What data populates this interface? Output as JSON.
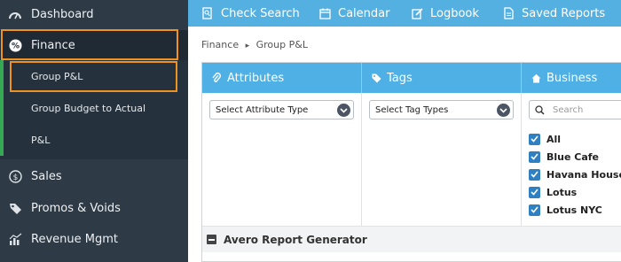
{
  "sidebar": {
    "dashboard": "Dashboard",
    "finance": "Finance",
    "finance_sub": [
      "Group P&L",
      "Group Budget to Actual",
      "P&L"
    ],
    "sales": "Sales",
    "promos": "Promos & Voids",
    "revenue": "Revenue Mgmt"
  },
  "topbar": {
    "check_search": "Check Search",
    "calendar": "Calendar",
    "logbook": "Logbook",
    "saved_reports": "Saved Reports"
  },
  "breadcrumb": [
    "Finance",
    "▸",
    "Group P&L"
  ],
  "panel": {
    "attributes": {
      "title": "Attributes",
      "select_value": "Select Attribute Type"
    },
    "tags": {
      "title": "Tags",
      "select_value": "Select Tag Types"
    },
    "business": {
      "title": "Business",
      "search_placeholder": "Search",
      "items": [
        {
          "label": "All",
          "checked": true
        },
        {
          "label": "Blue Cafe",
          "checked": true
        },
        {
          "label": "Havana House",
          "checked": true
        },
        {
          "label": "Lotus",
          "checked": true
        },
        {
          "label": "Lotus NYC",
          "checked": true
        }
      ]
    },
    "footer": "Avero Report Generator"
  },
  "colors": {
    "sidebar_bg": "#2e3a46",
    "accent_blue": "#55b0e2",
    "highlight_orange": "#f0921e",
    "active_green": "#34a853",
    "checkbox_blue": "#2f7fc1"
  }
}
